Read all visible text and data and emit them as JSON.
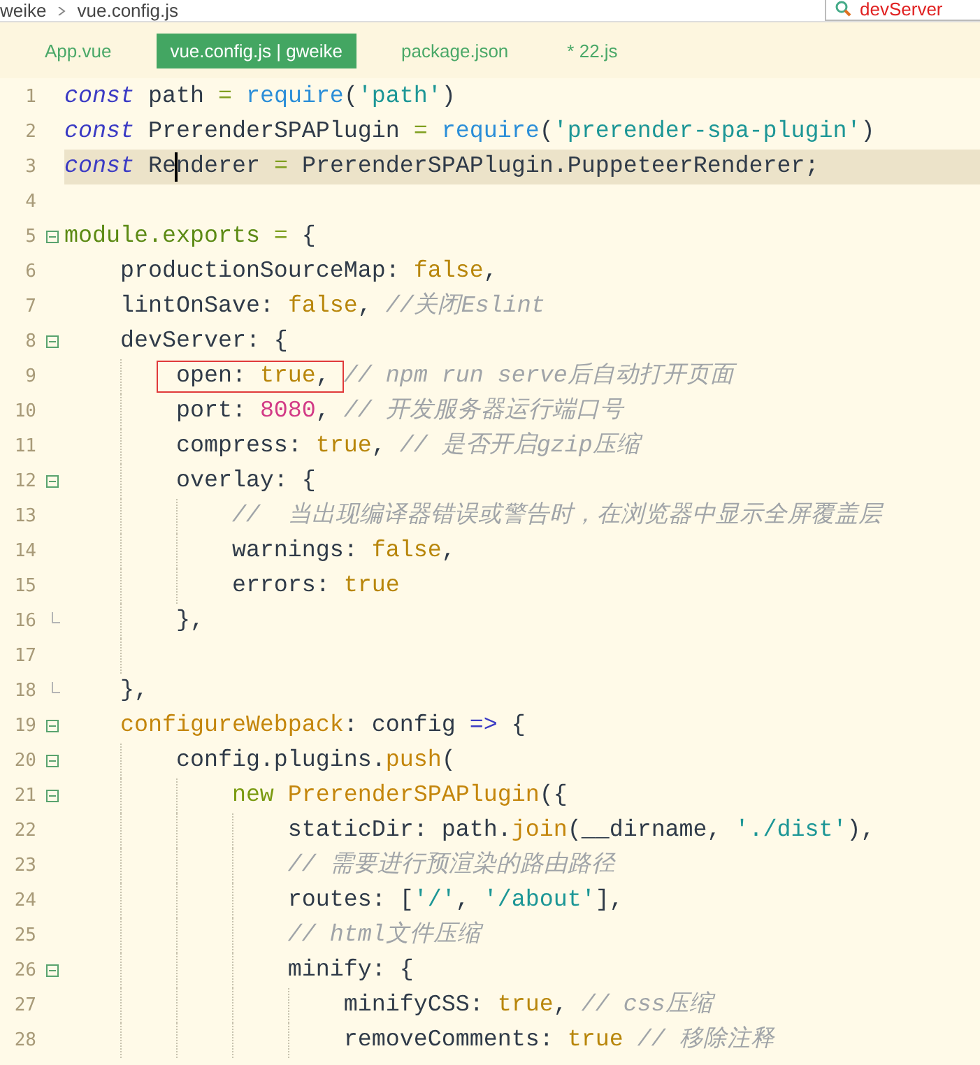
{
  "breadcrumb": [
    "weike",
    "vue.config.js"
  ],
  "search": {
    "value": "devServer"
  },
  "tabs": [
    {
      "label": "App.vue",
      "selected": false
    },
    {
      "label": "vue.config.js | gweike",
      "selected": true
    },
    {
      "label": "package.json",
      "selected": false
    },
    {
      "label": "* 22.js",
      "selected": false
    }
  ],
  "lines": [
    {
      "number": "1",
      "current": false,
      "boxed": false,
      "collapsible": false,
      "fold_end": false,
      "tokens": [
        {
          "kind": "keyword",
          "text": "const"
        },
        {
          "kind": "plain",
          "text": " path "
        },
        {
          "kind": "operator",
          "text": "="
        },
        {
          "kind": "function",
          "text": " require"
        },
        {
          "kind": "plain",
          "text": "("
        },
        {
          "kind": "string",
          "text": "'path'"
        },
        {
          "kind": "plain",
          "text": ")"
        }
      ]
    },
    {
      "number": "2",
      "current": false,
      "boxed": false,
      "collapsible": false,
      "fold_end": false,
      "tokens": [
        {
          "kind": "keyword",
          "text": "const"
        },
        {
          "kind": "plain",
          "text": " PrerenderSPAPlugin "
        },
        {
          "kind": "operator",
          "text": "="
        },
        {
          "kind": "function",
          "text": " require"
        },
        {
          "kind": "plain",
          "text": "("
        },
        {
          "kind": "string",
          "text": "'prerender-spa-plugin'"
        },
        {
          "kind": "plain",
          "text": ")"
        }
      ]
    },
    {
      "number": "3",
      "current": true,
      "boxed": false,
      "collapsible": false,
      "fold_end": false,
      "tokens": [
        {
          "kind": "keyword",
          "text": "const"
        },
        {
          "kind": "plain",
          "text": " Re",
          "caret": false
        },
        {
          "kind": "plain",
          "text": "nderer ",
          "caret": true
        },
        {
          "kind": "operator",
          "text": "="
        },
        {
          "kind": "plain",
          "text": " PrerenderSPAPlugin.PuppeteerRenderer;"
        }
      ]
    },
    {
      "number": "4",
      "current": false,
      "boxed": false,
      "collapsible": false,
      "fold_end": false
    },
    {
      "number": "5",
      "current": false,
      "boxed": false,
      "collapsible": true,
      "fold_end": false,
      "tokens": [
        {
          "kind": "module",
          "text": "module.exports"
        },
        {
          "kind": "operator",
          "text": " ="
        },
        {
          "kind": "plain",
          "text": " {"
        }
      ]
    },
    {
      "number": "6",
      "current": false,
      "boxed": false,
      "collapsible": false,
      "fold_end": false,
      "tokens": [
        {
          "kind": "plain",
          "text": "    productionSourceMap: "
        },
        {
          "kind": "boolean",
          "text": "false"
        },
        {
          "kind": "plain",
          "text": ","
        }
      ]
    },
    {
      "number": "7",
      "current": false,
      "boxed": false,
      "collapsible": false,
      "fold_end": false,
      "tokens": [
        {
          "kind": "plain",
          "text": "    lintOnSave: "
        },
        {
          "kind": "boolean",
          "text": "false"
        },
        {
          "kind": "plain",
          "text": ", "
        },
        {
          "kind": "comment",
          "text": "//关闭Eslint"
        }
      ]
    },
    {
      "number": "8",
      "current": false,
      "boxed": false,
      "collapsible": true,
      "fold_end": false,
      "tokens": [
        {
          "kind": "plain",
          "text": "    devServer: {"
        }
      ]
    },
    {
      "number": "9",
      "current": false,
      "boxed": true,
      "collapsible": false,
      "fold_end": false,
      "tokens": [
        {
          "kind": "plain",
          "text": "        open: "
        },
        {
          "kind": "boolean",
          "text": "true"
        },
        {
          "kind": "plain",
          "text": ","
        },
        {
          "kind": "comment",
          "text": " // npm run serve后自动打开页面"
        }
      ]
    },
    {
      "number": "10",
      "current": false,
      "boxed": false,
      "collapsible": false,
      "fold_end": false,
      "tokens": [
        {
          "kind": "plain",
          "text": "        port: "
        },
        {
          "kind": "number",
          "text": "8080"
        },
        {
          "kind": "plain",
          "text": ", "
        },
        {
          "kind": "comment",
          "text": "// 开发服务器运行端口号"
        }
      ]
    },
    {
      "number": "11",
      "current": false,
      "boxed": false,
      "collapsible": false,
      "fold_end": false,
      "tokens": [
        {
          "kind": "plain",
          "text": "        compress: "
        },
        {
          "kind": "boolean",
          "text": "true"
        },
        {
          "kind": "plain",
          "text": ", "
        },
        {
          "kind": "comment",
          "text": "// 是否开启gzip压缩"
        }
      ]
    },
    {
      "number": "12",
      "current": false,
      "boxed": false,
      "collapsible": true,
      "fold_end": false,
      "tokens": [
        {
          "kind": "plain",
          "text": "        overlay: {"
        }
      ]
    },
    {
      "number": "13",
      "current": false,
      "boxed": false,
      "collapsible": false,
      "fold_end": false,
      "tokens": [
        {
          "kind": "comment",
          "text": "            //  当出现编译器错误或警告时，在浏览器中显示全屏覆盖层"
        }
      ]
    },
    {
      "number": "14",
      "current": false,
      "boxed": false,
      "collapsible": false,
      "fold_end": false,
      "tokens": [
        {
          "kind": "plain",
          "text": "            warnings: "
        },
        {
          "kind": "boolean",
          "text": "false"
        },
        {
          "kind": "plain",
          "text": ","
        }
      ]
    },
    {
      "number": "15",
      "current": false,
      "boxed": false,
      "collapsible": false,
      "fold_end": false,
      "tokens": [
        {
          "kind": "plain",
          "text": "            errors: "
        },
        {
          "kind": "boolean",
          "text": "true"
        }
      ]
    },
    {
      "number": "16",
      "current": false,
      "boxed": false,
      "collapsible": false,
      "fold_end": true,
      "tokens": [
        {
          "kind": "plain",
          "text": "        },"
        }
      ]
    },
    {
      "number": "17",
      "current": false,
      "boxed": false,
      "collapsible": false,
      "fold_end": false
    },
    {
      "number": "18",
      "current": false,
      "boxed": false,
      "collapsible": false,
      "fold_end": true,
      "tokens": [
        {
          "kind": "plain",
          "text": "    },"
        }
      ]
    },
    {
      "number": "19",
      "current": false,
      "boxed": false,
      "collapsible": true,
      "fold_end": false,
      "tokens": [
        {
          "kind": "method",
          "text": "    configureWebpack"
        },
        {
          "kind": "plain",
          "text": ": config "
        },
        {
          "kind": "arrow",
          "text": "=>"
        },
        {
          "kind": "plain",
          "text": " {"
        }
      ]
    },
    {
      "number": "20",
      "current": false,
      "boxed": false,
      "collapsible": true,
      "fold_end": false,
      "tokens": [
        {
          "kind": "plain",
          "text": "        config.plugins."
        },
        {
          "kind": "method",
          "text": "push"
        },
        {
          "kind": "plain",
          "text": "("
        }
      ]
    },
    {
      "number": "21",
      "current": false,
      "boxed": false,
      "collapsible": true,
      "fold_end": false,
      "tokens": [
        {
          "kind": "new",
          "text": "            new"
        },
        {
          "kind": "method",
          "text": " PrerenderSPAPlugin"
        },
        {
          "kind": "plain",
          "text": "({"
        }
      ]
    },
    {
      "number": "22",
      "current": false,
      "boxed": false,
      "collapsible": false,
      "fold_end": false,
      "tokens": [
        {
          "kind": "plain",
          "text": "                staticDir: path."
        },
        {
          "kind": "method",
          "text": "join"
        },
        {
          "kind": "plain",
          "text": "(__dirname, "
        },
        {
          "kind": "string",
          "text": "'./dist'"
        },
        {
          "kind": "plain",
          "text": "),"
        }
      ]
    },
    {
      "number": "23",
      "current": false,
      "boxed": false,
      "collapsible": false,
      "fold_end": false,
      "tokens": [
        {
          "kind": "comment",
          "text": "                // 需要进行预渲染的路由路径"
        }
      ]
    },
    {
      "number": "24",
      "current": false,
      "boxed": false,
      "collapsible": false,
      "fold_end": false,
      "tokens": [
        {
          "kind": "plain",
          "text": "                routes: ["
        },
        {
          "kind": "string",
          "text": "'/'"
        },
        {
          "kind": "plain",
          "text": ", "
        },
        {
          "kind": "string",
          "text": "'/about'"
        },
        {
          "kind": "plain",
          "text": "],"
        }
      ]
    },
    {
      "number": "25",
      "current": false,
      "boxed": false,
      "collapsible": false,
      "fold_end": false,
      "tokens": [
        {
          "kind": "comment",
          "text": "                // html文件压缩"
        }
      ]
    },
    {
      "number": "26",
      "current": false,
      "boxed": false,
      "collapsible": true,
      "fold_end": false,
      "tokens": [
        {
          "kind": "plain",
          "text": "                minify: {"
        }
      ]
    },
    {
      "number": "27",
      "current": false,
      "boxed": false,
      "collapsible": false,
      "fold_end": false,
      "tokens": [
        {
          "kind": "plain",
          "text": "                    minifyCSS: "
        },
        {
          "kind": "boolean",
          "text": "true"
        },
        {
          "kind": "plain",
          "text": ", "
        },
        {
          "kind": "comment",
          "text": "// css压缩"
        }
      ]
    },
    {
      "number": "28",
      "current": false,
      "boxed": false,
      "collapsible": false,
      "fold_end": false,
      "tokens": [
        {
          "kind": "plain",
          "text": "                    removeComments: "
        },
        {
          "kind": "boolean",
          "text": "true"
        },
        {
          "kind": "comment",
          "text": " // 移除注释"
        }
      ]
    }
  ]
}
